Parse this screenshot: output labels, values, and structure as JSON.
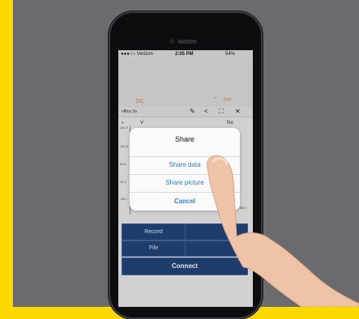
{
  "status_bar": {
    "carrier": "●●●○○ Verizon",
    "time": "2:05 PM",
    "battery": "54%"
  },
  "readout": {
    "mode": "DC",
    "unit": "mv"
  },
  "toolbar": {
    "file_name": "office 2a",
    "icons": [
      "edit-icon",
      "share-icon",
      "fullscreen-icon",
      "close-icon"
    ]
  },
  "chart": {
    "label_v": "v",
    "label_V": "V",
    "label_No": "No",
    "ticks": [
      "162.2",
      "112.8",
      "63.5",
      "14.2",
      "-35.1",
      "65.0"
    ]
  },
  "buttons": {
    "record": "Record",
    "file": "File",
    "connect": "Connect"
  },
  "share_sheet": {
    "title": "Share",
    "share_data": "Share data",
    "share_picture": "Share picture",
    "cancel": "Cancel"
  },
  "colors": {
    "background_left_border": "#fbd800",
    "backdrop": "#6b6a6f",
    "accent_orange": "#e8963c",
    "ios_blue": "#2f7fd6",
    "button_navy": "#1e3d6b"
  }
}
